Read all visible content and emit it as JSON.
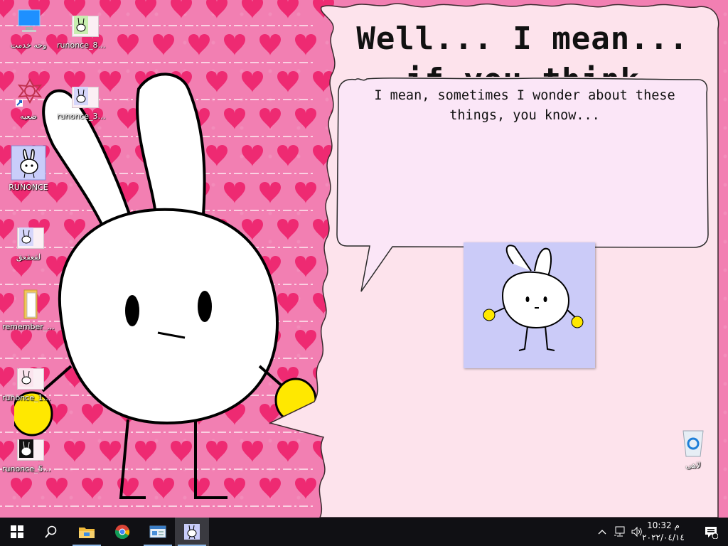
{
  "desktop": {
    "icons": [
      {
        "label": "وحه خدمت"
      },
      {
        "label": "runonce_82..."
      },
      {
        "label": "صعيه"
      },
      {
        "label": "runonce_33..."
      },
      {
        "label": "RUNONCE"
      },
      {
        "label": "لقعقعق"
      },
      {
        "label": "remember_..."
      },
      {
        "label": "runonce_13..."
      },
      {
        "label": "runonce_57..."
      }
    ],
    "recycle_bin": {
      "label": "لاهی"
    }
  },
  "popup": {
    "headline": "Well... I mean... if you think about it",
    "bubble_text": "I mean, sometimes I wonder about these things, you know..."
  },
  "taskbar": {
    "clock_time": "10:32 م",
    "clock_date": "٢٠٢٢/٠٤/١٤",
    "icons": [
      "windows-start-icon",
      "search-icon",
      "file-explorer-icon",
      "chrome-icon",
      "app-window-icon",
      "bunny-app-icon"
    ]
  },
  "colors": {
    "wallpaper": "#f27fb2",
    "heart": "#ee2a72",
    "popup_bg": "#fde3ec",
    "bubble_bg": "#fbe6f7",
    "taskbar": "#101014"
  }
}
